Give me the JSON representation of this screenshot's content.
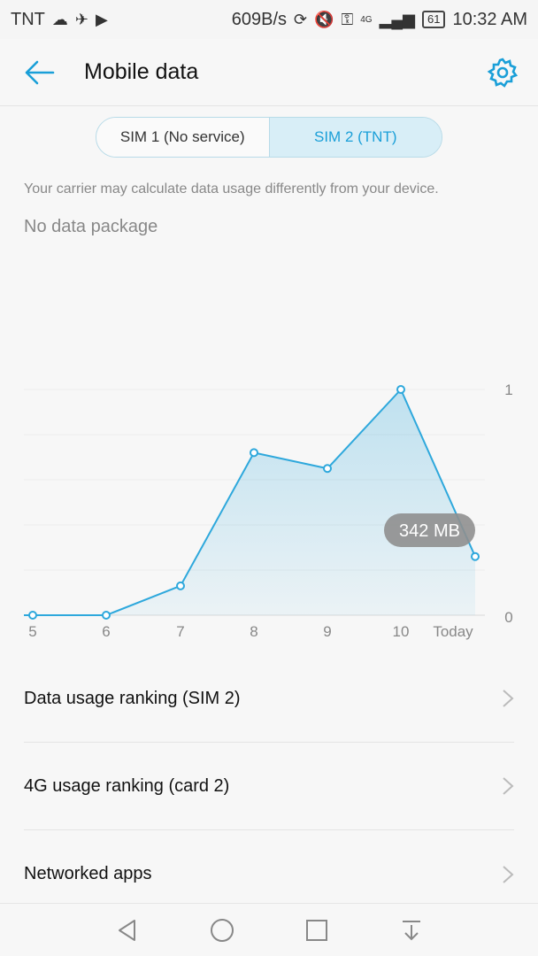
{
  "status_bar": {
    "carrier": "TNT",
    "net_speed": "609B/s",
    "network_type": "4G",
    "battery": "61",
    "time": "10:32 AM",
    "icons_left": [
      "cloud-icon",
      "satellite-icon",
      "youtube-icon"
    ],
    "icons_right": [
      "sync-icon",
      "mute-icon",
      "key-icon",
      "signal-icon"
    ]
  },
  "app_bar": {
    "title": "Mobile data"
  },
  "sim_tabs": [
    {
      "label": "SIM 1 (No service)",
      "selected": false
    },
    {
      "label": "SIM 2 (TNT)",
      "selected": true
    }
  ],
  "notice": "Your carrier may calculate data usage differently from your device.",
  "package_text": "No data package",
  "chart_data": {
    "type": "area",
    "categories": [
      "5",
      "6",
      "7",
      "8",
      "9",
      "10",
      "Today"
    ],
    "values": [
      0,
      0,
      0.13,
      0.72,
      0.65,
      1,
      0.26
    ],
    "ylim": [
      0,
      1
    ],
    "y_ticks": [
      "0",
      "1"
    ],
    "tooltip": "342 MB",
    "grid": true,
    "accent": "#2ea8dc"
  },
  "list_items": [
    {
      "label": "Data usage ranking (SIM 2)"
    },
    {
      "label": "4G usage ranking (card 2)"
    },
    {
      "label": "Networked apps"
    }
  ],
  "nav_bar": [
    "back-icon",
    "home-icon",
    "recents-icon",
    "notification-pull-icon"
  ],
  "colors": {
    "accent": "#1a9fd8",
    "selected_tab_bg": "#d8eef7"
  }
}
